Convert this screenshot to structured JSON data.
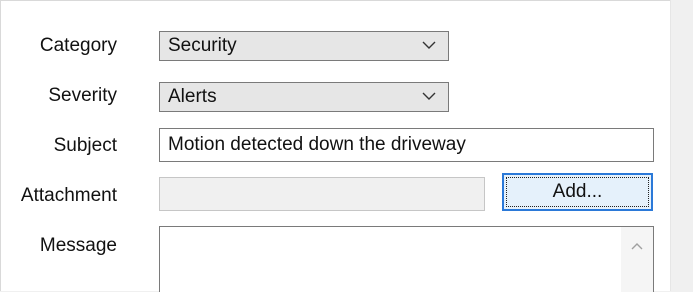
{
  "form": {
    "category": {
      "label": "Category",
      "value": "Security"
    },
    "severity": {
      "label": "Severity",
      "value": "Alerts"
    },
    "subject": {
      "label": "Subject",
      "value": "Motion detected down the driveway"
    },
    "attachment": {
      "label": "Attachment",
      "value": "",
      "button_label": "Add..."
    },
    "message": {
      "label": "Message",
      "value": ""
    }
  },
  "icons": {
    "dropdown": "chevron-down-icon",
    "scroll_up": "chevron-up-icon"
  }
}
